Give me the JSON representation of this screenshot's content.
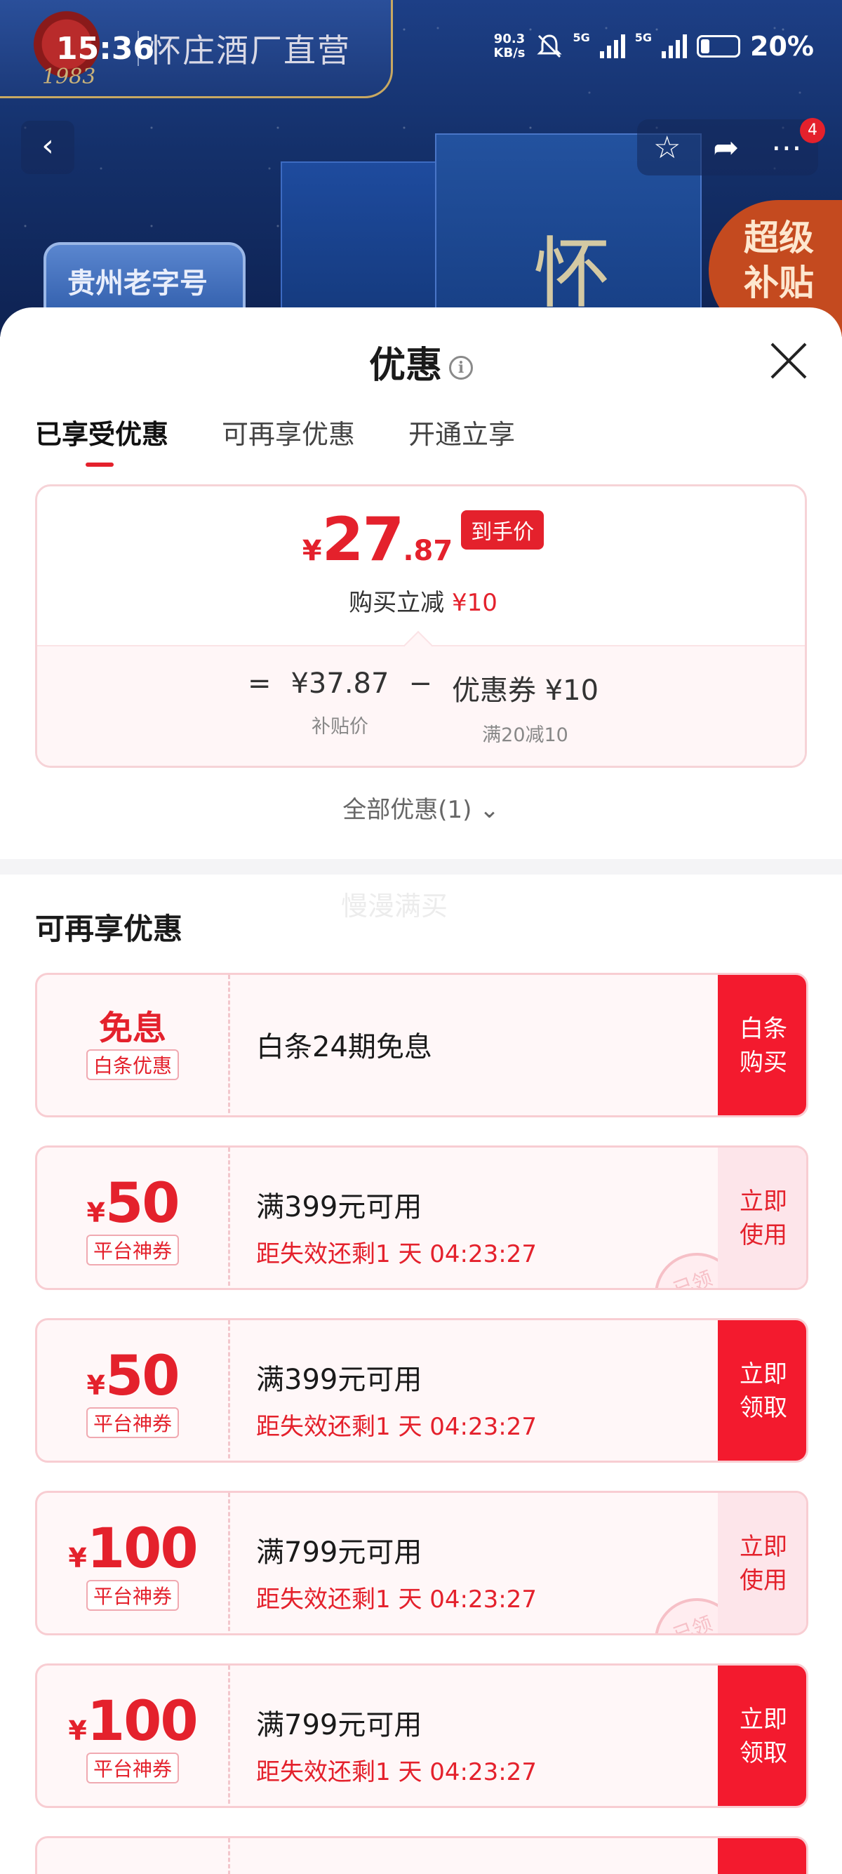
{
  "status_bar": {
    "time": "15:36",
    "net_speed_value": "90.3",
    "net_speed_unit": "KB/s",
    "signal_1_label": "5G",
    "signal_2_label": "5G",
    "battery": "20%"
  },
  "hero": {
    "brand_name": "怀庄酒厂直营",
    "brand_year": "1983",
    "badge_left": "贵州老字号",
    "badge_right_line1": "超级",
    "badge_right_line2": "补贴",
    "product_char": "怀",
    "notification_count": "4",
    "colors": {
      "hero_bg": "#14306a",
      "badge_orange": "#c44a1f"
    }
  },
  "sheet": {
    "title": "优惠",
    "tabs": [
      {
        "label": "已享受优惠",
        "active": true
      },
      {
        "label": "可再享优惠",
        "active": false
      },
      {
        "label": "开通立享",
        "active": false
      }
    ],
    "price": {
      "currency": "¥",
      "integer": "27",
      "decimal": ".87",
      "tag": "到手价",
      "reduction_prefix": "购买立减",
      "reduction_value": "¥10"
    },
    "formula": {
      "equals": "=",
      "subsidy_value": "¥37.87",
      "subsidy_label": "补贴价",
      "minus": "−",
      "coupon_value": "优惠券 ¥10",
      "coupon_label": "满20减10"
    },
    "all_discounts": "全部优惠(1)",
    "watermark": "慢漫满买",
    "section_title": "可再享优惠",
    "accent_color": "#e4212c"
  },
  "coupons": [
    {
      "amount": "免息",
      "is_word": true,
      "tag": "白条优惠",
      "condition": "白条24期免息",
      "timer": "",
      "button_line1": "白条",
      "button_line2": "购买",
      "button_style": "solid",
      "stamp": ""
    },
    {
      "amount": "50",
      "currency": "¥",
      "is_word": false,
      "tag": "平台神券",
      "condition": "满399元可用",
      "timer": "距失效还剩1 天 04:23:27",
      "button_line1": "立即",
      "button_line2": "使用",
      "button_style": "soft",
      "stamp": "已领"
    },
    {
      "amount": "50",
      "currency": "¥",
      "is_word": false,
      "tag": "平台神券",
      "condition": "满399元可用",
      "timer": "距失效还剩1 天 04:23:27",
      "button_line1": "立即",
      "button_line2": "领取",
      "button_style": "solid",
      "stamp": ""
    },
    {
      "amount": "100",
      "currency": "¥",
      "is_word": false,
      "tag": "平台神券",
      "condition": "满799元可用",
      "timer": "距失效还剩1 天 04:23:27",
      "button_line1": "立即",
      "button_line2": "使用",
      "button_style": "soft",
      "stamp": "已领"
    },
    {
      "amount": "100",
      "currency": "¥",
      "is_word": false,
      "tag": "平台神券",
      "condition": "满799元可用",
      "timer": "距失效还剩1 天 04:23:27",
      "button_line1": "立即",
      "button_line2": "领取",
      "button_style": "solid",
      "stamp": ""
    }
  ]
}
